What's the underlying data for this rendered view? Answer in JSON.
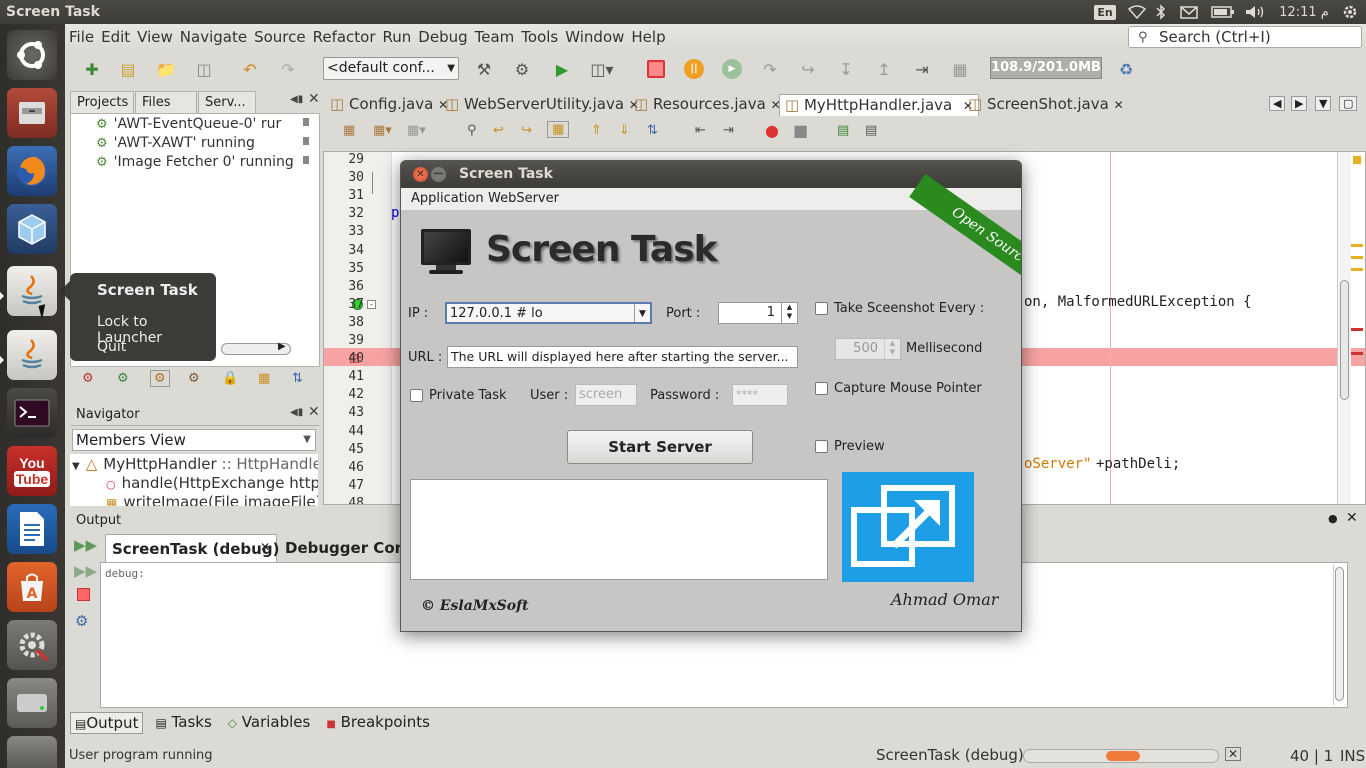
{
  "top_panel": {
    "title": "Screen Task",
    "lang": "En",
    "clock": "12:11 م",
    "icons": [
      "network-icon",
      "bluetooth-icon",
      "mail-icon",
      "battery-icon",
      "volume-icon",
      "power-gear-icon"
    ]
  },
  "launcher": {
    "items": [
      "ubuntu-dash-icon",
      "file-manager-icon",
      "firefox-icon",
      "virtualbox-icon",
      "java-app-icon",
      "java-app-icon",
      "terminal-icon",
      "youtube-icon",
      "libreoffice-writer-icon",
      "software-center-icon",
      "system-settings-icon",
      "disk-icon"
    ]
  },
  "context_menu": {
    "title": "Screen Task",
    "items": [
      "Lock to Launcher",
      "Quit"
    ]
  },
  "menubar": {
    "items": [
      "File",
      "Edit",
      "View",
      "Navigate",
      "Source",
      "Refactor",
      "Run",
      "Debug",
      "Team",
      "Tools",
      "Window",
      "Help"
    ],
    "search_placeholder": "Search (Ctrl+I)"
  },
  "toolbar": {
    "config": "<default conf...",
    "memory": "108.9/201.0MB"
  },
  "projects_panel": {
    "tabs": [
      "Projects",
      "Files",
      "Serv..."
    ],
    "threads": [
      "'AWT-EventQueue-0' rur",
      "'AWT-XAWT' running",
      "'Image Fetcher 0' running"
    ]
  },
  "navigator": {
    "title": "Navigator",
    "view": "Members View",
    "class_name": "MyHttpHandler",
    "class_suffix": " :: HttpHandle",
    "members": [
      {
        "name": "handle",
        "args": "(HttpExchange httpE"
      },
      {
        "name": "writeImage",
        "args": "(File imageFile)"
      }
    ]
  },
  "editor": {
    "tabs": [
      "Config.java",
      "WebServerUtility.java",
      "Resources.java",
      "MyHttpHandler.java",
      "ScreenShot.java"
    ],
    "line_numbers": [
      "29",
      "30",
      "31",
      "32",
      "33",
      "34",
      "35",
      "36",
      "37",
      "38",
      "39",
      "40",
      "41",
      "42",
      "43",
      "44",
      "45",
      "46",
      "47",
      "48"
    ],
    "code_fragments": {
      "l32": "pu",
      "l37": "on, MalformedURLException {",
      "l46a": "oServer\"",
      "l46b": "+pathDeli;"
    }
  },
  "output": {
    "title": "Output",
    "tabs": [
      "ScreenTask (debug)",
      "Debugger Conso"
    ],
    "text": "debug:"
  },
  "bottom_tabs": [
    "Output",
    "Tasks",
    "Variables",
    "Breakpoints"
  ],
  "status": {
    "left": "User program running",
    "task": "ScreenTask (debug)",
    "position": "40 | 1",
    "mode": "INS"
  },
  "dialog": {
    "title": "Screen Task",
    "menu": [
      "Application",
      "WebServer"
    ],
    "banner_title": "Screen Task",
    "ribbon": "Open Source",
    "ip_label": "IP :",
    "ip_value": "127.0.0.1 # lo",
    "port_label": "Port :",
    "port_value": "1",
    "url_label": "URL :",
    "url_value": "The URL will displayed here after starting the server...",
    "private_task": "Private Task",
    "user_label": "User :",
    "user_value": "screen",
    "password_label": "Password :",
    "password_value": "****",
    "start_button": "Start Server",
    "screenshot_every": "Take Sceenshot Every :",
    "interval": "500",
    "interval_unit": "Mellisecond",
    "capture_mouse": "Capture Mouse Pointer",
    "preview": "Preview",
    "copyright": "© EslaMxSoft",
    "author": "Ahmad Omar",
    "colors": {
      "preview_tile": "#1f9ee8",
      "ribbon": "#2a8a1e"
    }
  }
}
